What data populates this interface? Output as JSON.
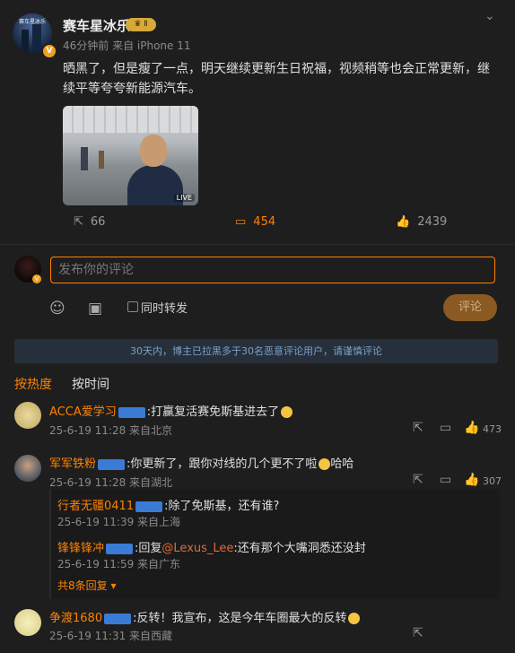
{
  "post": {
    "author": "赛车星冰乐",
    "avatar_label": "赛车星冰乐",
    "verified_badge": "V",
    "rank_badge": "Ⅱ",
    "meta": "46分钟前 来自 iPhone 11",
    "text": "晒黑了，但是瘦了一点，明天继续更新生日祝福，视频稍等也会正常更新，继续平等夸夸新能源汽车。",
    "photo_badge": "LIVE",
    "actions": {
      "repost": "66",
      "comment": "454",
      "like": "2439"
    },
    "icons": {
      "repost": "share-icon",
      "comment": "comment-icon",
      "like": "thumbs-up-icon",
      "menu": "chevron-down-icon"
    }
  },
  "composer": {
    "placeholder": "发布你的评论",
    "repost_label": "同时转发",
    "submit_label": "评论",
    "emoji_icon": "emoji-icon",
    "image_icon": "image-icon",
    "avatar_badge": "V"
  },
  "notice": "30天内，博主已拉黑多于30名恶意评论用户，请谨慎评论",
  "sort_tabs": {
    "hot": "按热度",
    "time": "按时间"
  },
  "accent_color": "#ff8200",
  "comments": [
    {
      "name": "ACCA爱学习",
      "fan": "铁粉4",
      "text": ":打赢复活赛免斯基进去了",
      "meta": "25-6-19 11:28 来自北京",
      "likes": "473"
    },
    {
      "name": "军军铁粉",
      "fan": "铁粉1",
      "text": ":你更新了，跟你对线的几个更不了啦",
      "text_tail": "哈哈",
      "meta": "25-6-19 11:28 来自湖北",
      "likes": "307",
      "replies": [
        {
          "name": "行者无疆0411",
          "fan": "铁粉1",
          "text": ":除了免斯基，还有谁?",
          "meta": "25-6-19 11:39 来自上海"
        },
        {
          "name": "锋锋锋冲",
          "fan": "铁粉1",
          "text_prefix": ":回复",
          "mention": "@Lexus_Lee",
          "text": ":还有那个大嘴洞悉还没封",
          "meta": "25-6-19 11:59 来自广东"
        }
      ],
      "more": "共8条回复"
    },
    {
      "name": "争渡1680",
      "fan": "铁粉1",
      "text": ":反转！我宣布，这是今年车圈最大的反转",
      "meta": "25-6-19 11:31 来自西藏"
    }
  ]
}
